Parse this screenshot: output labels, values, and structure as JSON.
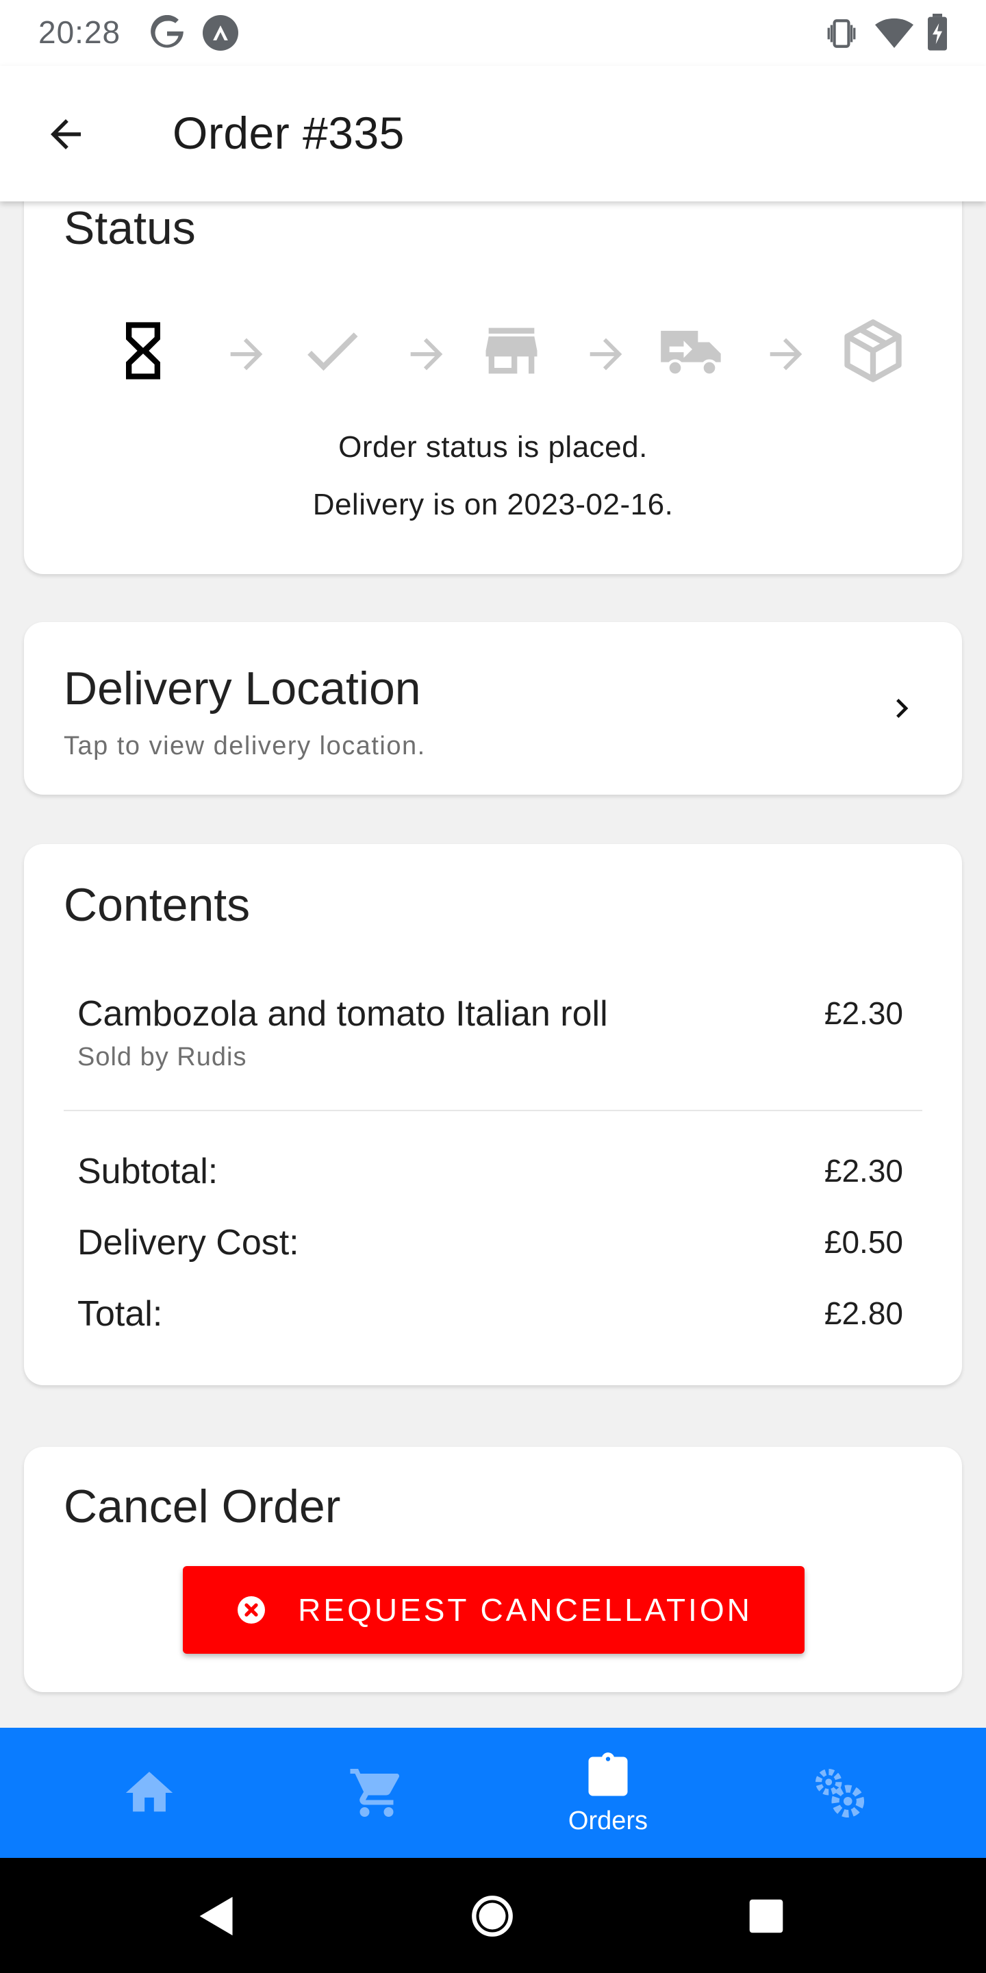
{
  "status_bar": {
    "time": "20:28",
    "left_icons": [
      "google-g-icon",
      "android-a-icon"
    ],
    "right_icons": [
      "vibrate-icon",
      "wifi-icon",
      "battery-charging-icon"
    ]
  },
  "app_bar": {
    "title": "Order #335",
    "back_icon": "arrow-left-icon"
  },
  "status_card": {
    "title": "Status",
    "steps": [
      {
        "name": "placed",
        "icon": "hourglass-icon",
        "active": true
      },
      {
        "name": "confirmed",
        "icon": "check-icon",
        "active": false
      },
      {
        "name": "store",
        "icon": "store-icon",
        "active": false
      },
      {
        "name": "delivering",
        "icon": "truck-icon",
        "active": false
      },
      {
        "name": "delivered",
        "icon": "package-icon",
        "active": false
      }
    ],
    "status_text": "Order status is placed.",
    "delivery_text": "Delivery is on 2023-02-16."
  },
  "location_card": {
    "title": "Delivery Location",
    "subtitle": "Tap to view delivery location."
  },
  "contents_card": {
    "title": "Contents",
    "items": [
      {
        "name": "Cambozola and tomato Italian roll",
        "seller": "Sold by Rudis",
        "price": "£2.30"
      }
    ],
    "subtotal_label": "Subtotal:",
    "subtotal_value": "£2.30",
    "delivery_label": "Delivery Cost:",
    "delivery_value": "£0.50",
    "total_label": "Total:",
    "total_value": "£2.80"
  },
  "cancel_card": {
    "title": "Cancel Order",
    "button_label": "REQUEST CANCELLATION"
  },
  "bottom_nav": {
    "items": [
      {
        "icon": "home-icon",
        "label": "",
        "active": false
      },
      {
        "icon": "cart-icon",
        "label": "",
        "active": false
      },
      {
        "icon": "clipboard-icon",
        "label": "Orders",
        "active": true
      },
      {
        "icon": "settings-icon",
        "label": "",
        "active": false
      }
    ]
  },
  "colors": {
    "accent_red": "#ff0000",
    "nav_blue": "#0a7cff",
    "inactive_step": "#c8c8c8"
  }
}
